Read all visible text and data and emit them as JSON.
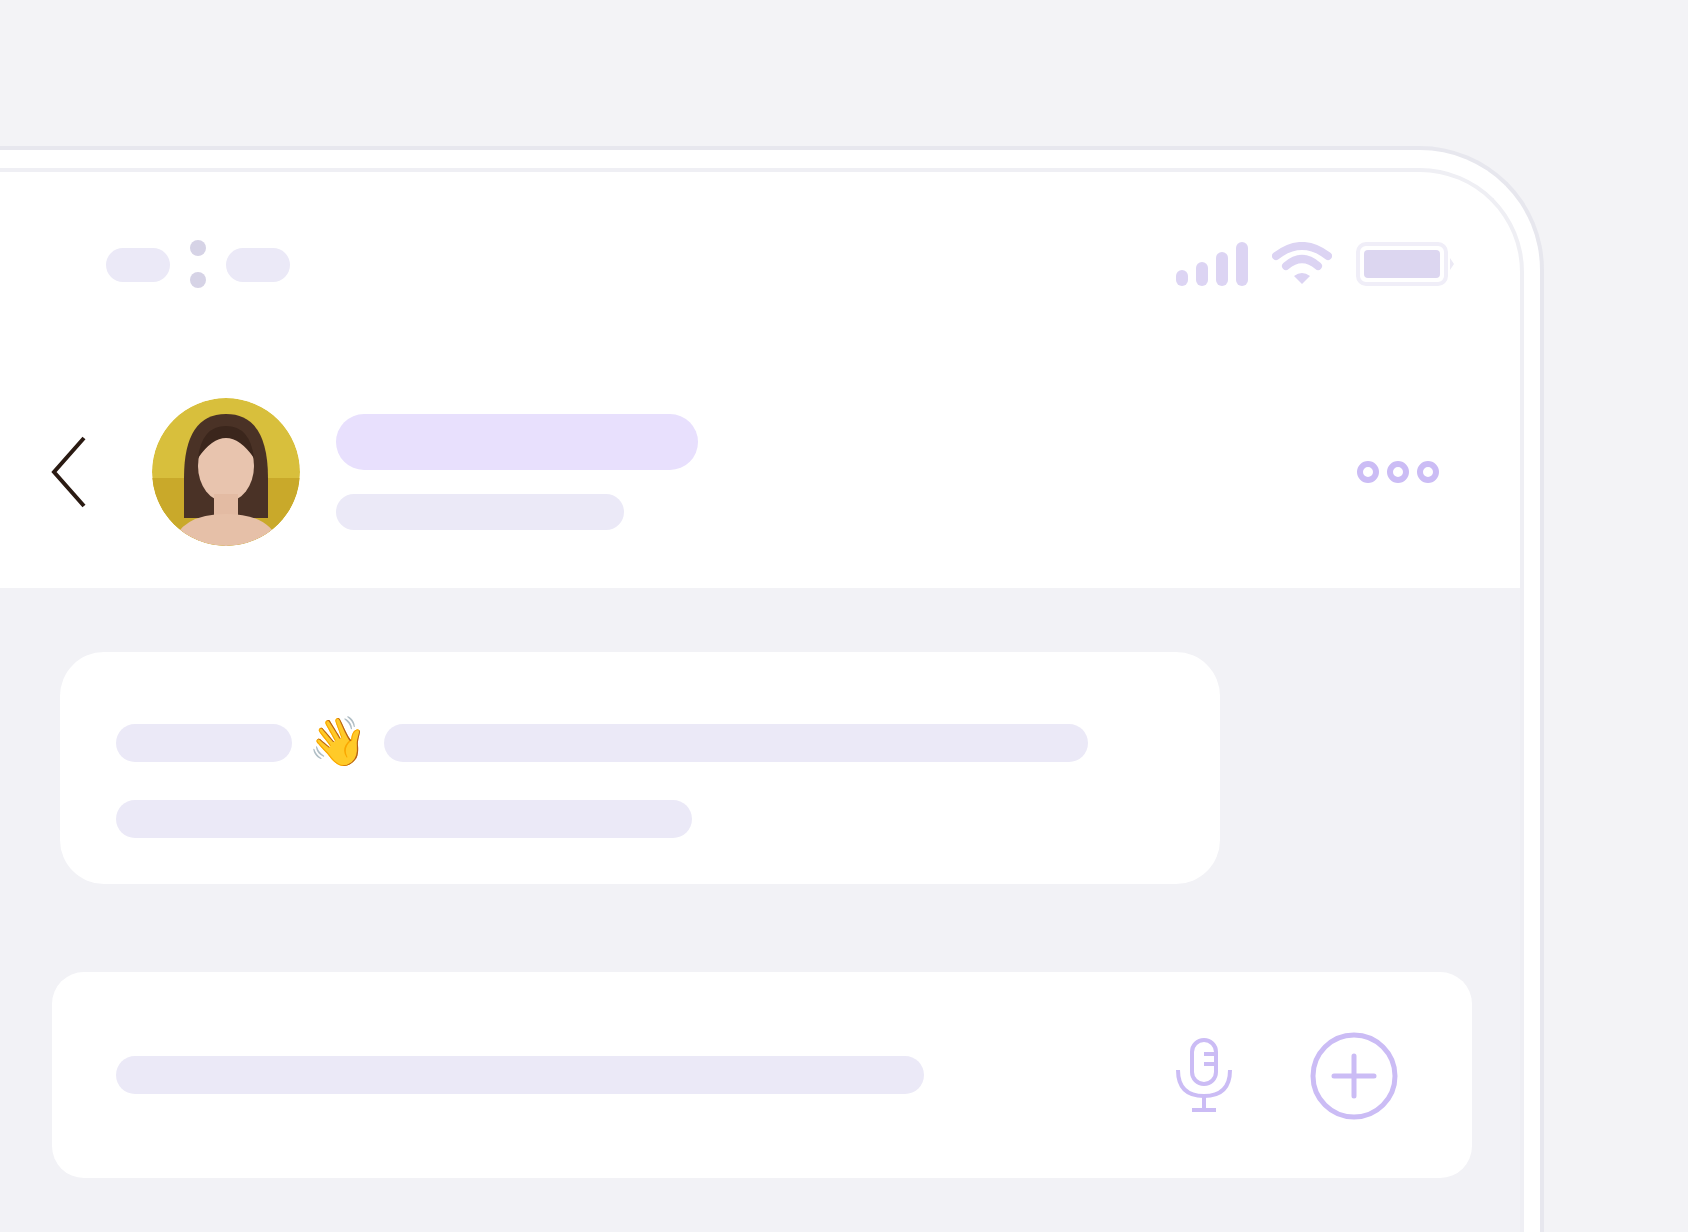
{
  "message": {
    "emoji": "👋"
  }
}
